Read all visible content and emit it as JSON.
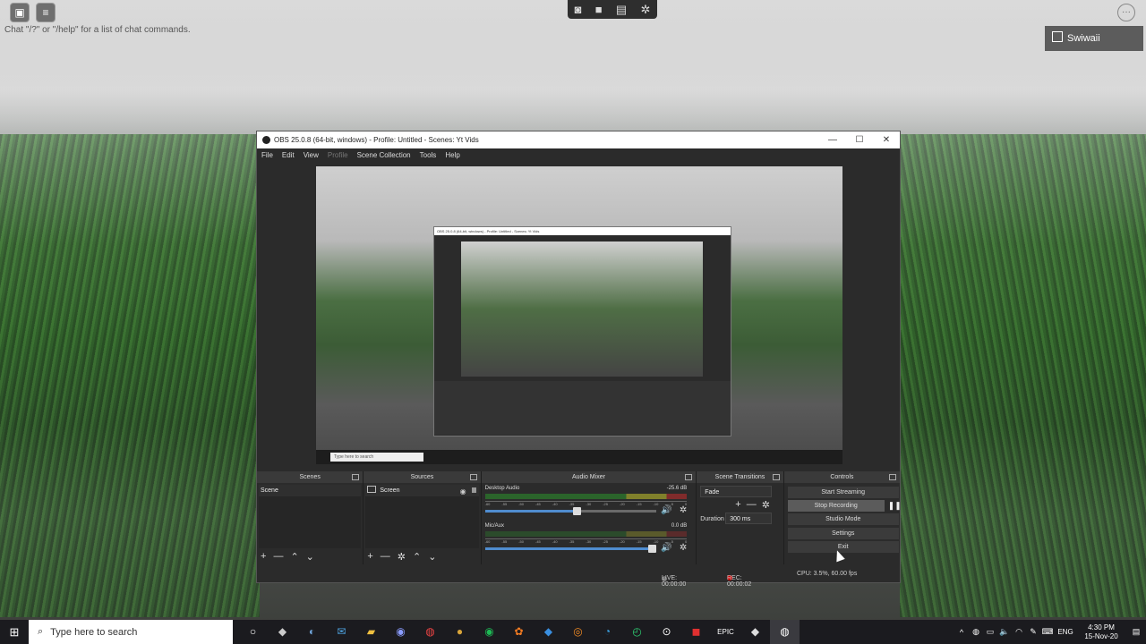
{
  "game": {
    "chat_hint": "Chat \"/?\" or \"/help\" for a list of chat commands.",
    "username": "Swiwaii",
    "more_icon": "ellipsis-circle-icon"
  },
  "obs": {
    "title": "OBS 25.0.8 (64-bit, windows) - Profile: Untitled - Scenes: Yt Vids",
    "menu": [
      "File",
      "Edit",
      "View",
      "Profile",
      "Scene Collection",
      "Tools",
      "Help"
    ],
    "docks": {
      "scenes": {
        "title": "Scenes",
        "items": [
          "Scene"
        ]
      },
      "sources": {
        "title": "Sources",
        "items": [
          "Screen"
        ]
      },
      "mixer": {
        "title": "Audio Mixer",
        "channels": [
          {
            "name": "Desktop Audio",
            "db": "-25.6 dB",
            "level": 0.56
          },
          {
            "name": "Mic/Aux",
            "db": "0.0 dB",
            "level": 1.0
          }
        ],
        "ticks": [
          "-60",
          "-55",
          "-50",
          "-45",
          "-40",
          "-35",
          "-30",
          "-25",
          "-20",
          "-15",
          "-10",
          "-5",
          "0"
        ]
      },
      "transitions": {
        "title": "Scene Transitions",
        "selected": "Fade",
        "duration_label": "Duration",
        "duration_value": "300 ms"
      },
      "controls": {
        "title": "Controls",
        "start_streaming": "Start Streaming",
        "stop_recording": "Stop Recording",
        "studio_mode": "Studio Mode",
        "settings": "Settings",
        "exit": "Exit"
      }
    },
    "status": {
      "live": "LIVE: 00:00:00",
      "rec": "REC: 00:00:02",
      "cpu": "CPU: 3.5%, 60.00 fps"
    },
    "preview_search": "Type here to search"
  },
  "taskbar": {
    "search_placeholder": "Type here to search",
    "lang": "ENG",
    "time": "4:30 PM",
    "date": "15-Nov-20"
  },
  "colors": {
    "obs_bg": "#2b2b2b",
    "rec": "#cc0000",
    "fader": "#4f8ccf"
  }
}
